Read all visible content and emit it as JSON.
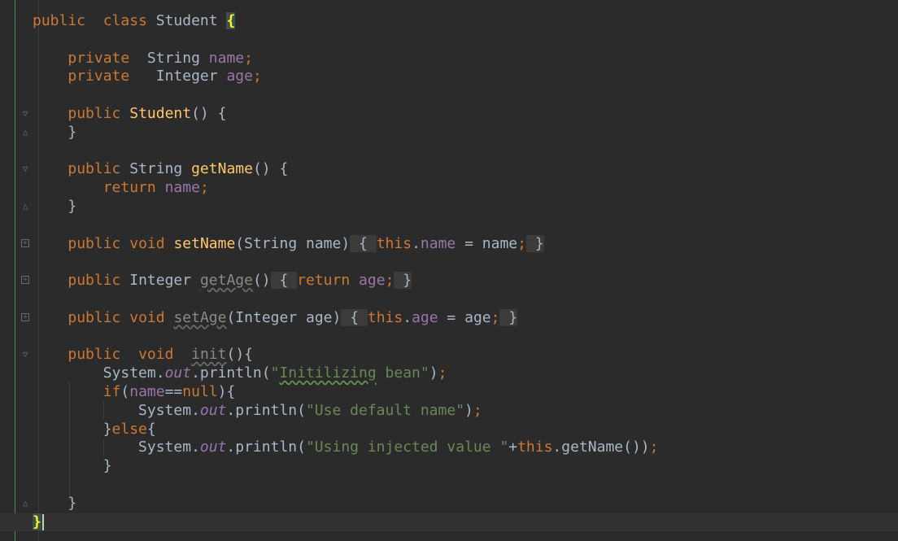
{
  "editor": {
    "language": "java",
    "colors": {
      "background": "#2b2b2b",
      "keyword": "#cc7832",
      "method": "#ffc66d",
      "field": "#9876aa",
      "string": "#6a8759",
      "text": "#a9b7c6"
    },
    "lines": [
      {
        "tokens": [
          [
            "kw",
            "public"
          ],
          [
            "",
            "  "
          ],
          [
            "kw",
            "class"
          ],
          [
            "",
            " Student "
          ],
          [
            "brace",
            "{"
          ]
        ]
      },
      {
        "tokens": []
      },
      {
        "tokens": [
          [
            "",
            "    "
          ],
          [
            "kw",
            "private"
          ],
          [
            "",
            "  String "
          ],
          [
            "field",
            "name"
          ],
          [
            "kw",
            ";"
          ]
        ]
      },
      {
        "tokens": [
          [
            "",
            "    "
          ],
          [
            "kw",
            "private"
          ],
          [
            "",
            "   Integer "
          ],
          [
            "field",
            "age"
          ],
          [
            "kw",
            ";"
          ]
        ]
      },
      {
        "tokens": []
      },
      {
        "tokens": [
          [
            "",
            "    "
          ],
          [
            "kw",
            "public"
          ],
          [
            "",
            " "
          ],
          [
            "fn",
            "Student"
          ],
          [
            "",
            "() {"
          ]
        ]
      },
      {
        "tokens": [
          [
            "",
            "    }"
          ]
        ]
      },
      {
        "tokens": []
      },
      {
        "tokens": [
          [
            "",
            "    "
          ],
          [
            "kw",
            "public"
          ],
          [
            "",
            " String "
          ],
          [
            "fn",
            "getName"
          ],
          [
            "",
            "() {"
          ]
        ]
      },
      {
        "tokens": [
          [
            "",
            "        "
          ],
          [
            "kw",
            "return"
          ],
          [
            "",
            " "
          ],
          [
            "field",
            "name"
          ],
          [
            "kw",
            ";"
          ]
        ]
      },
      {
        "tokens": [
          [
            "",
            "    }"
          ]
        ]
      },
      {
        "tokens": []
      },
      {
        "tokens": [
          [
            "",
            "    "
          ],
          [
            "kw",
            "public"
          ],
          [
            "",
            " "
          ],
          [
            "kw",
            "void"
          ],
          [
            "",
            " "
          ],
          [
            "fn",
            "setName"
          ],
          [
            "",
            "(String name)"
          ],
          [
            "fold",
            " { "
          ],
          [
            "kw",
            "this"
          ],
          [
            "",
            "."
          ],
          [
            "field",
            "name"
          ],
          [
            "",
            " = name"
          ],
          [
            "kw",
            ";"
          ],
          [
            "fold",
            " }"
          ]
        ]
      },
      {
        "tokens": []
      },
      {
        "tokens": [
          [
            "",
            "    "
          ],
          [
            "kw",
            "public"
          ],
          [
            "",
            " Integer "
          ],
          [
            "unused",
            "getAge"
          ],
          [
            "",
            "()"
          ],
          [
            "fold",
            " { "
          ],
          [
            "kw",
            "return"
          ],
          [
            "",
            " "
          ],
          [
            "field",
            "age"
          ],
          [
            "kw",
            ";"
          ],
          [
            "fold",
            " }"
          ]
        ]
      },
      {
        "tokens": []
      },
      {
        "tokens": [
          [
            "",
            "    "
          ],
          [
            "kw",
            "public"
          ],
          [
            "",
            " "
          ],
          [
            "kw",
            "void"
          ],
          [
            "",
            " "
          ],
          [
            "unused",
            "setAge"
          ],
          [
            "",
            "(Integer age)"
          ],
          [
            "fold",
            " { "
          ],
          [
            "kw",
            "this"
          ],
          [
            "",
            "."
          ],
          [
            "field",
            "age"
          ],
          [
            "",
            " = age"
          ],
          [
            "kw",
            ";"
          ],
          [
            "fold",
            " }"
          ]
        ]
      },
      {
        "tokens": []
      },
      {
        "tokens": [
          [
            "",
            "    "
          ],
          [
            "kw",
            "public"
          ],
          [
            "",
            "  "
          ],
          [
            "kw",
            "void"
          ],
          [
            "",
            "  "
          ],
          [
            "unused",
            "init"
          ],
          [
            "",
            "(){"
          ]
        ]
      },
      {
        "tokens": [
          [
            "",
            "        System."
          ],
          [
            "static",
            "out"
          ],
          [
            "",
            ".println("
          ],
          [
            "str",
            "\""
          ],
          [
            "strtypo",
            "Initilizing"
          ],
          [
            "str",
            " bean\""
          ],
          [
            "",
            ")"
          ],
          [
            "kw",
            ";"
          ]
        ]
      },
      {
        "tokens": [
          [
            "",
            "        "
          ],
          [
            "kw",
            "if"
          ],
          [
            "",
            "("
          ],
          [
            "field",
            "name"
          ],
          [
            "",
            "=="
          ],
          [
            "kw",
            "null"
          ],
          [
            "",
            "){"
          ]
        ]
      },
      {
        "tokens": [
          [
            "",
            "            System."
          ],
          [
            "static",
            "out"
          ],
          [
            "",
            ".println("
          ],
          [
            "str",
            "\"Use default name\""
          ],
          [
            "",
            ")"
          ],
          [
            "kw",
            ";"
          ]
        ]
      },
      {
        "tokens": [
          [
            "",
            "        }"
          ],
          [
            "kw",
            "else"
          ],
          [
            "",
            "{"
          ]
        ]
      },
      {
        "tokens": [
          [
            "",
            "            System."
          ],
          [
            "static",
            "out"
          ],
          [
            "",
            ".println("
          ],
          [
            "str",
            "\"Using injected value \""
          ],
          [
            "",
            "+"
          ],
          [
            "kw",
            "this"
          ],
          [
            "",
            ".getName())"
          ],
          [
            "kw",
            ";"
          ]
        ]
      },
      {
        "tokens": [
          [
            "",
            "        }"
          ]
        ]
      },
      {
        "tokens": []
      },
      {
        "tokens": [
          [
            "",
            "    }"
          ]
        ]
      },
      {
        "tokens": [
          [
            "brace",
            "}"
          ],
          [
            "caret",
            ""
          ]
        ],
        "current": true
      }
    ],
    "fold_icons": [
      {
        "line": 5,
        "kind": "open"
      },
      {
        "line": 6,
        "kind": "close"
      },
      {
        "line": 8,
        "kind": "open"
      },
      {
        "line": 10,
        "kind": "close"
      },
      {
        "line": 12,
        "kind": "plus"
      },
      {
        "line": 14,
        "kind": "plus"
      },
      {
        "line": 16,
        "kind": "plus"
      },
      {
        "line": 18,
        "kind": "open"
      },
      {
        "line": 26,
        "kind": "close"
      }
    ]
  }
}
